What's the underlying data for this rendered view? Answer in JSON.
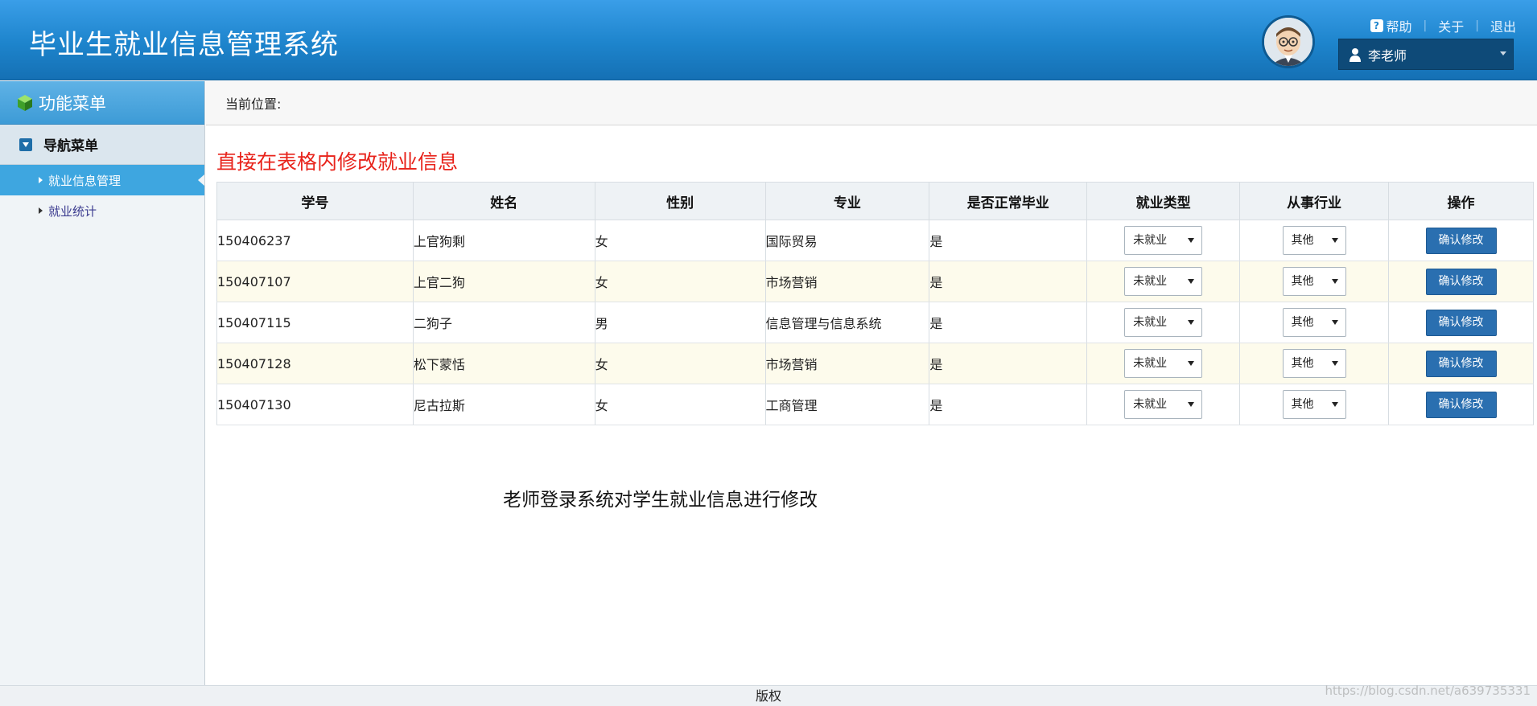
{
  "header": {
    "title": "毕业生就业信息管理系统",
    "links": {
      "help": "帮助",
      "about": "关于",
      "logout": "退出"
    },
    "user": "李老师"
  },
  "sidebar": {
    "title": "功能菜单",
    "nav_heading": "导航菜单",
    "items": [
      {
        "label": "就业信息管理",
        "active": true
      },
      {
        "label": "就业统计",
        "active": false
      }
    ]
  },
  "breadcrumb": {
    "label": "当前位置:"
  },
  "main": {
    "heading": "直接在表格内修改就业信息",
    "columns": [
      "学号",
      "姓名",
      "性别",
      "专业",
      "是否正常毕业",
      "就业类型",
      "从事行业",
      "操作"
    ],
    "rows": [
      {
        "id": "150406237",
        "name": "上官狗剩",
        "gender": "女",
        "major": "国际贸易",
        "graduated": "是",
        "employment_type": "未就业",
        "industry": "其他",
        "action": "确认修改"
      },
      {
        "id": "150407107",
        "name": "上官二狗",
        "gender": "女",
        "major": "市场营销",
        "graduated": "是",
        "employment_type": "未就业",
        "industry": "其他",
        "action": "确认修改"
      },
      {
        "id": "150407115",
        "name": "二狗子",
        "gender": "男",
        "major": "信息管理与信息系统",
        "graduated": "是",
        "employment_type": "未就业",
        "industry": "其他",
        "action": "确认修改"
      },
      {
        "id": "150407128",
        "name": "松下蒙恬",
        "gender": "女",
        "major": "市场营销",
        "graduated": "是",
        "employment_type": "未就业",
        "industry": "其他",
        "action": "确认修改"
      },
      {
        "id": "150407130",
        "name": "尼古拉斯",
        "gender": "女",
        "major": "工商管理",
        "graduated": "是",
        "employment_type": "未就业",
        "industry": "其他",
        "action": "确认修改"
      }
    ],
    "caption": "老师登录系统对学生就业信息进行修改"
  },
  "footer": {
    "text": "版权"
  },
  "watermark": "https://blog.csdn.net/a639735331",
  "colors": {
    "header_blue": "#1d84cc",
    "heading_red": "#e8231b",
    "button_blue": "#2a6fb0",
    "active_nav": "#3ea6e0"
  }
}
